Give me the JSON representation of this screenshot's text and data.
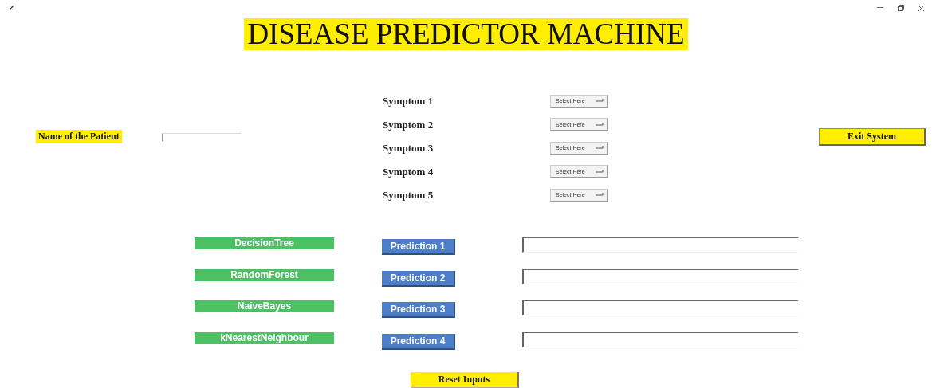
{
  "title": "DISEASE PREDICTOR MACHINE",
  "patient": {
    "label": "Name of the Patient"
  },
  "symptoms": [
    {
      "label": "Symptom 1",
      "value": "Select Here"
    },
    {
      "label": "Symptom 2",
      "value": "Select Here"
    },
    {
      "label": "Symptom 3",
      "value": "Select Here"
    },
    {
      "label": "Symptom 4",
      "value": "Select Here"
    },
    {
      "label": "Symptom 5",
      "value": "Select Here"
    }
  ],
  "exit_button": "Exit System",
  "algorithms": [
    {
      "label": "DecisionTree",
      "button": "Prediction 1"
    },
    {
      "label": "RandomForest",
      "button": "Prediction 2"
    },
    {
      "label": "NaiveBayes",
      "button": "Prediction 3"
    },
    {
      "label": "kNearestNeighbour",
      "button": "Prediction 4"
    }
  ],
  "reset_button": "Reset Inputs"
}
